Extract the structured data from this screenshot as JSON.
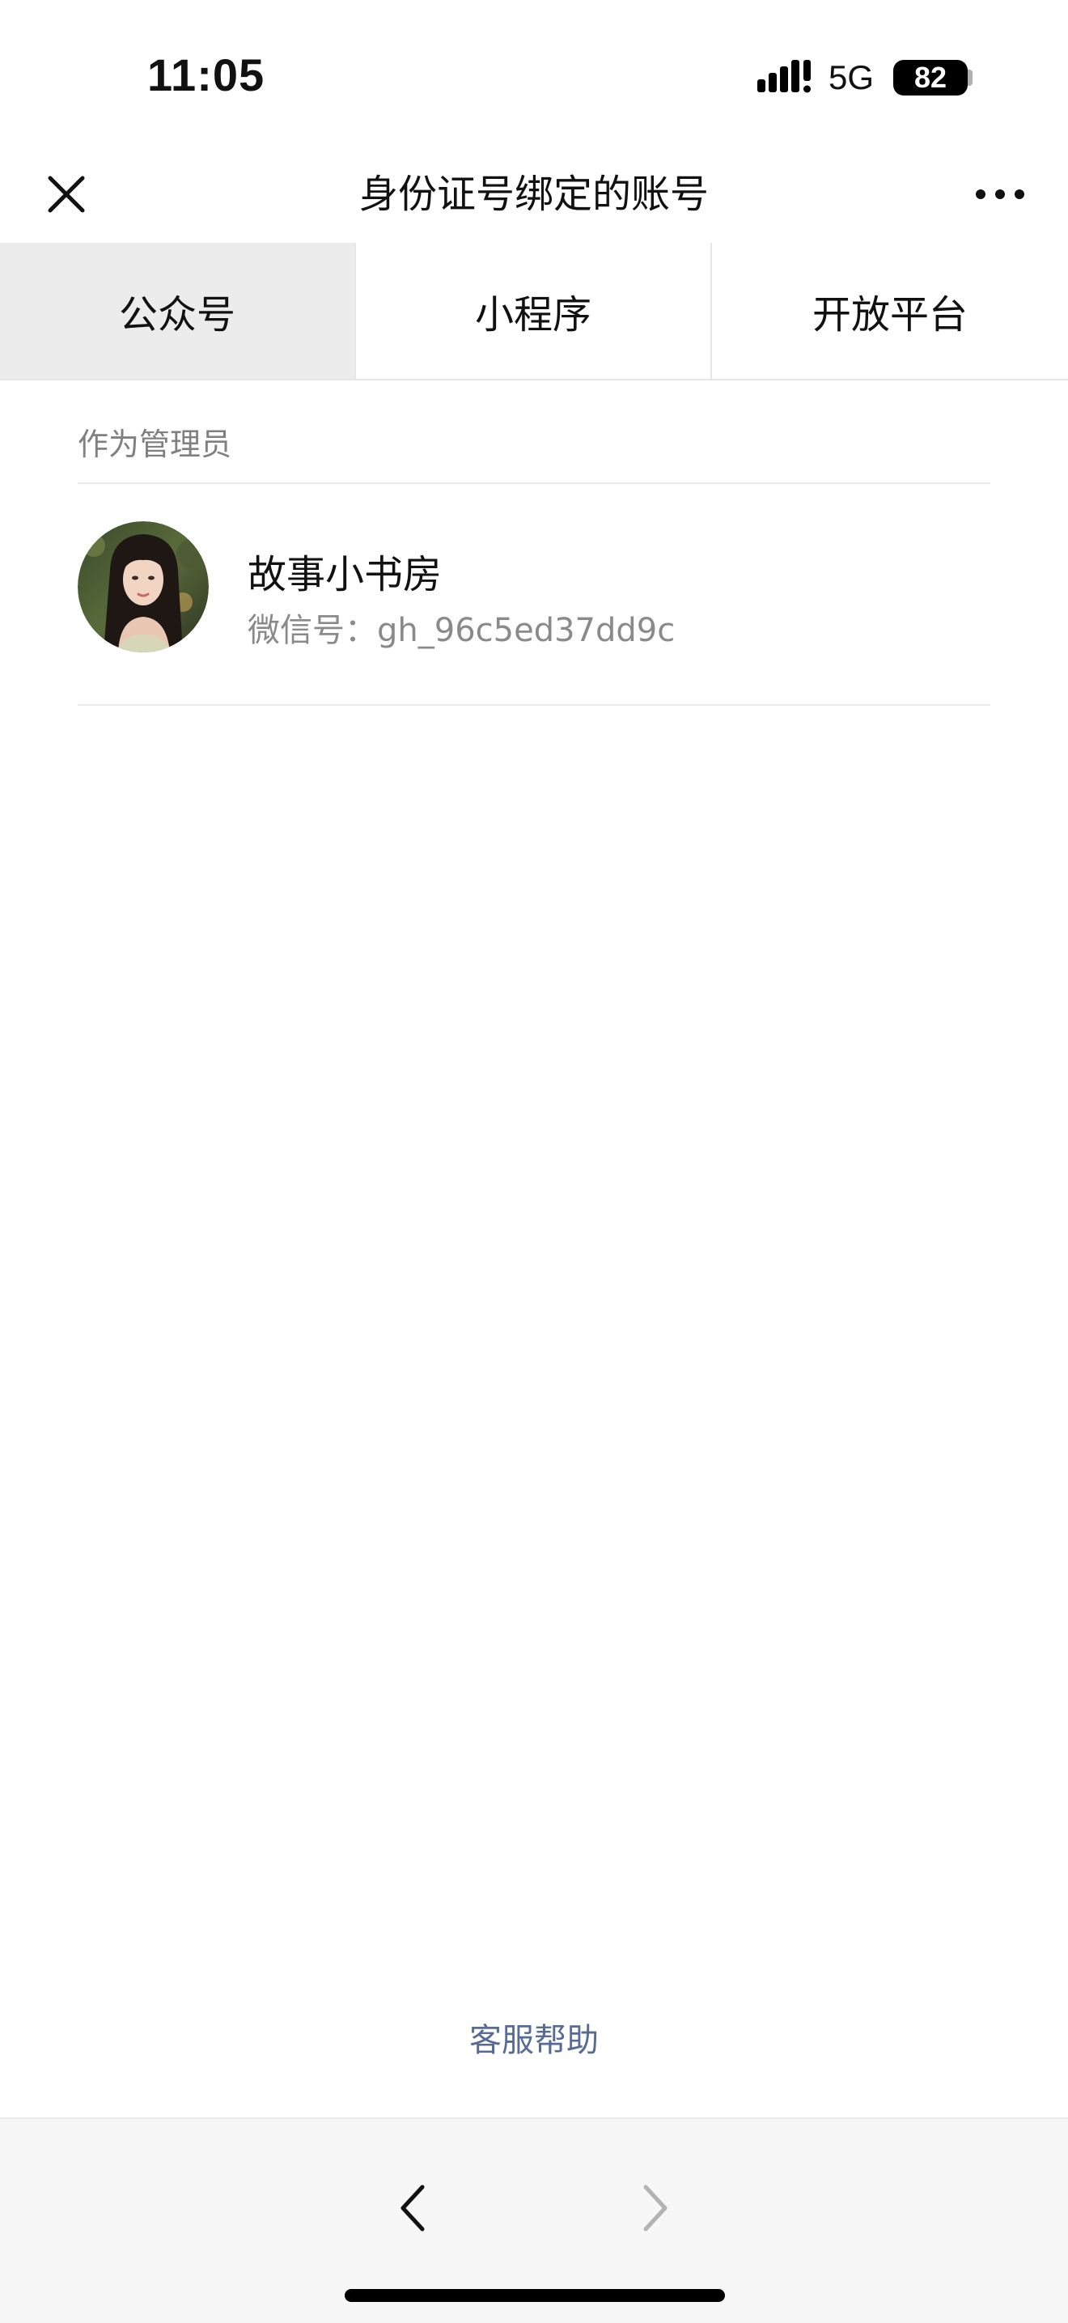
{
  "status_bar": {
    "time": "11:05",
    "network": "5G",
    "battery": "82"
  },
  "nav": {
    "title": "身份证号绑定的账号",
    "close_icon": "close-icon",
    "more_icon": "more-dots-icon"
  },
  "tabs": [
    {
      "label": "公众号",
      "active": true
    },
    {
      "label": "小程序",
      "active": false
    },
    {
      "label": "开放平台",
      "active": false
    }
  ],
  "section": {
    "header": "作为管理员"
  },
  "accounts": [
    {
      "name": "故事小书房",
      "wechat_id": "微信号：gh_96c5ed37dd9c"
    }
  ],
  "footer": {
    "help_link": "客服帮助"
  },
  "toolbar": {
    "back_icon": "chevron-left-icon",
    "forward_icon": "chevron-right-icon"
  },
  "colors": {
    "link": "#576b95",
    "active_tab_bg": "#ececec",
    "secondary_text": "#8a8a8a",
    "toolbar_bg": "#f7f7f7"
  }
}
